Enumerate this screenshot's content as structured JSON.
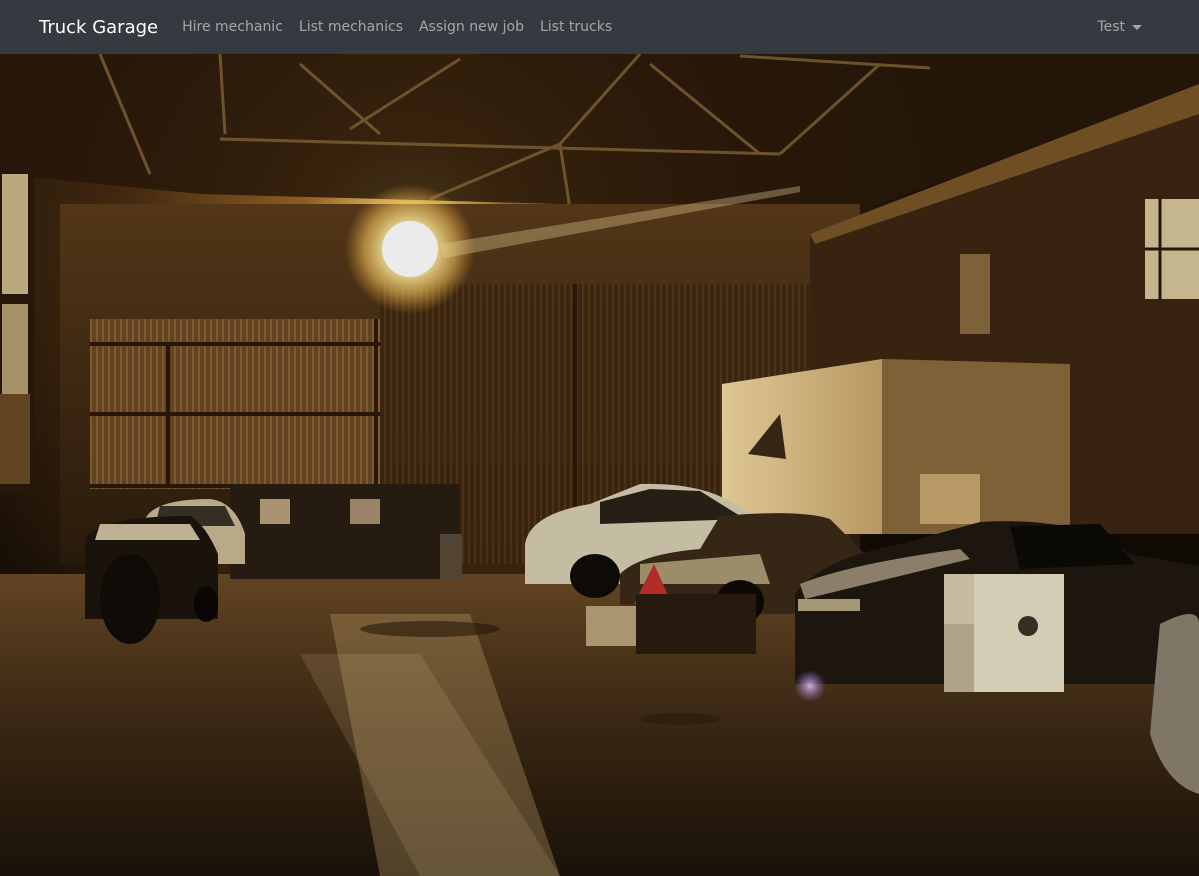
{
  "navbar": {
    "brand": "Truck Garage",
    "links": [
      {
        "label": "Hire mechanic"
      },
      {
        "label": "List mechanics"
      },
      {
        "label": "Assign new job"
      },
      {
        "label": "List trucks"
      }
    ],
    "user_menu": {
      "label": "Test",
      "icon": "caret-down-icon"
    }
  },
  "colors": {
    "navbar_bg": "#343a40",
    "brand_text": "#ffffff",
    "link_text": "rgba(255,255,255,0.55)"
  }
}
